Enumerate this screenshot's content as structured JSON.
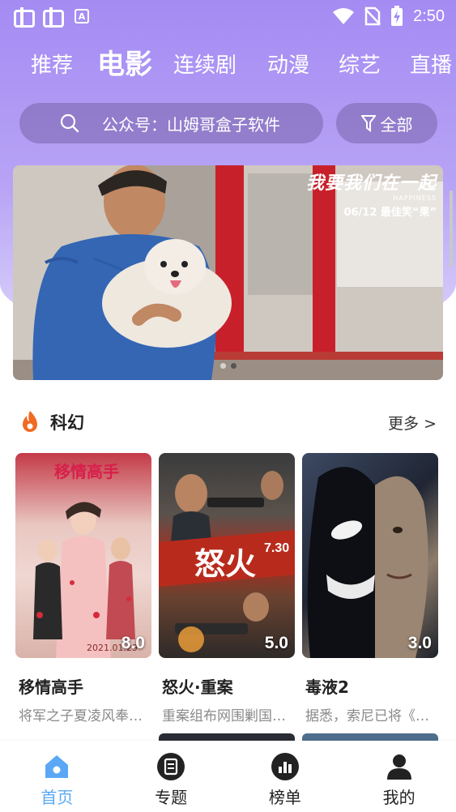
{
  "status_bar": {
    "time": "2:50",
    "left_icons": [
      "bug-icon",
      "bug-icon",
      "a-icon"
    ],
    "right_icons": [
      "wifi-icon",
      "no-sim-icon",
      "battery-charging-icon"
    ]
  },
  "tabs": [
    {
      "label": "推荐",
      "active": false
    },
    {
      "label": "电影",
      "active": true
    },
    {
      "label": "连续剧",
      "active": false
    },
    {
      "label": "动漫",
      "active": false
    },
    {
      "label": "综艺",
      "active": false
    },
    {
      "label": "直播",
      "active": false
    }
  ],
  "search": {
    "placeholder": "公众号：山姆哥盒子软件",
    "filter_label": "全部"
  },
  "banner": {
    "title": "我要我们在一起",
    "subtitle": "06/12 最佳笑“果”",
    "logo_sub": "HAPPINESS",
    "dot_count": 2,
    "active_dot": 1
  },
  "section": {
    "title": "科幻",
    "more_label": "更多 >"
  },
  "movies": [
    {
      "title": "移情高手",
      "desc": "将军之子夏凌风奉…",
      "score": "8.0",
      "poster_text": "移情高手",
      "poster_date": "2021.01.29"
    },
    {
      "title": "怒火·重案",
      "desc": "重案组布网围剿国…",
      "score": "5.0",
      "poster_text": "怒火",
      "poster_date": "7.30"
    },
    {
      "title": "毒液2",
      "desc": "据悉，索尼已将《…",
      "score": "3.0"
    }
  ],
  "bottom_nav": [
    {
      "label": "首页",
      "icon": "home-icon",
      "active": true
    },
    {
      "label": "专题",
      "icon": "topic-icon",
      "active": false
    },
    {
      "label": "榜单",
      "icon": "chart-icon",
      "active": false
    },
    {
      "label": "我的",
      "icon": "user-icon",
      "active": false
    }
  ],
  "colors": {
    "header_purple": "#a48bf3",
    "active_nav_blue": "#5aa8f5",
    "flame_orange": "#f06b23"
  }
}
